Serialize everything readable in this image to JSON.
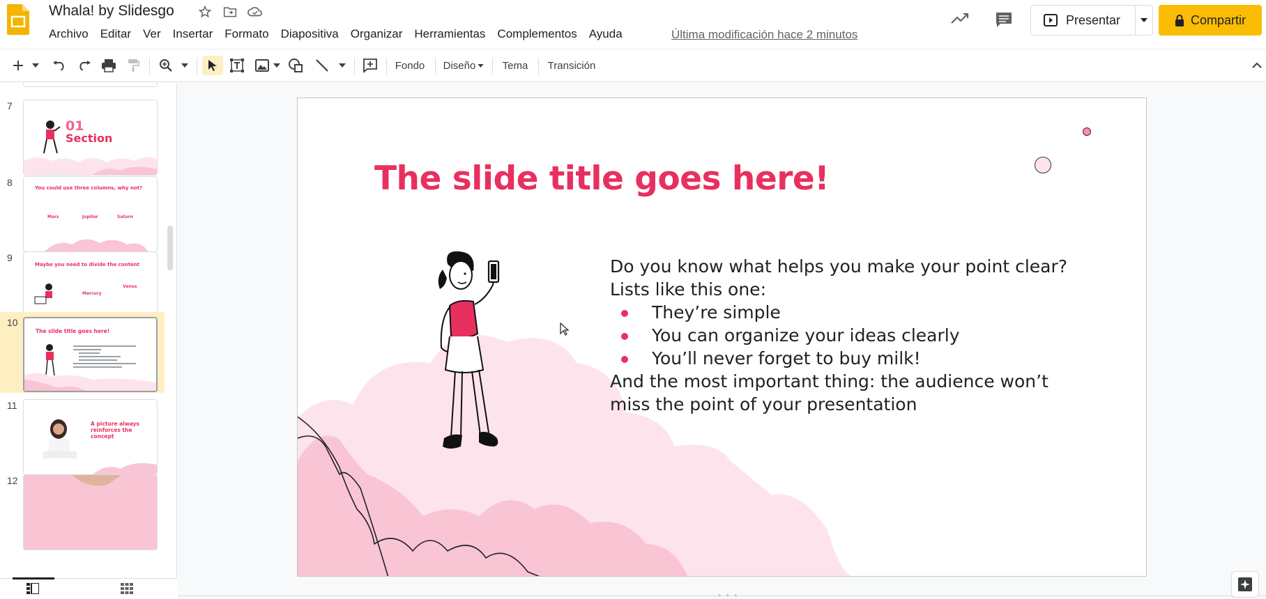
{
  "header": {
    "doc_title": "Whala! by Slidesgo",
    "menu": [
      "Archivo",
      "Editar",
      "Ver",
      "Insertar",
      "Formato",
      "Diapositiva",
      "Organizar",
      "Herramientas",
      "Complementos",
      "Ayuda"
    ],
    "last_modified": "Última modificación hace 2 minutos",
    "present_label": "Presentar",
    "share_label": "Compartir"
  },
  "toolbar": {
    "background_label": "Fondo",
    "layout_label": "Diseño",
    "theme_label": "Tema",
    "transition_label": "Transición"
  },
  "filmstrip": {
    "slides": [
      {
        "number": "7",
        "title": "01\nSection",
        "line1": "01",
        "line2": "Section"
      },
      {
        "number": "8",
        "title": "You could use three columns, why not?",
        "cols": [
          "Mars",
          "Jupiter",
          "Saturn"
        ]
      },
      {
        "number": "9",
        "title": "Maybe you need to divide the content",
        "cols": [
          "Mercury",
          "Venus"
        ]
      },
      {
        "number": "10",
        "title": "The slide title goes here!",
        "selected": true
      },
      {
        "number": "11",
        "title": "A picture always reinforces the concept",
        "line1": "A picture always",
        "line2": "reinforces the",
        "line3": "concept"
      },
      {
        "number": "12",
        "title": ""
      }
    ]
  },
  "slide": {
    "title": "The slide title goes here!",
    "intro_line1": "Do you know what helps you make your point clear?",
    "intro_line2": "Lists like this one:",
    "bullets": [
      "They’re simple",
      "You can organize your ideas clearly",
      "You’ll never forget to buy milk!"
    ],
    "outro": "And the most important thing: the audience won’t miss the point of your presentation"
  },
  "colors": {
    "accent": "#e8305f",
    "share_button": "#fbbc04",
    "selected_thumb": "#feefc3",
    "cloud_light": "#fde4ec",
    "cloud_mid": "#f9c5d5"
  }
}
